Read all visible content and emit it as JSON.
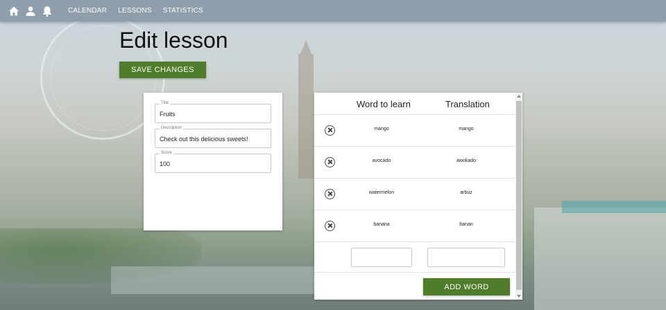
{
  "nav": {
    "icons": [
      "home-icon",
      "user-icon",
      "bell-icon"
    ],
    "links": [
      "CALENDAR",
      "LESSONS",
      "STATISTICS"
    ]
  },
  "page": {
    "title": "Edit lesson",
    "save_label": "SAVE CHANGES"
  },
  "form": {
    "title_label": "Title",
    "title_value": "Fruits",
    "description_label": "Description",
    "description_value": "Check out this delicious sweets!",
    "score_label": "Score",
    "score_value": "100"
  },
  "words": {
    "col_word": "Word to learn",
    "col_translation": "Translation",
    "rows": [
      {
        "word": "mango",
        "translation": "mango"
      },
      {
        "word": "avocado",
        "translation": "awokado"
      },
      {
        "word": "watermelon",
        "translation": "arbuz"
      },
      {
        "word": "banana",
        "translation": "banan"
      }
    ],
    "new_word_value": "",
    "new_translation_value": "",
    "add_label": "ADD WORD"
  },
  "colors": {
    "navbar": "#8e9eab",
    "accent_button": "#4f7d2a"
  }
}
